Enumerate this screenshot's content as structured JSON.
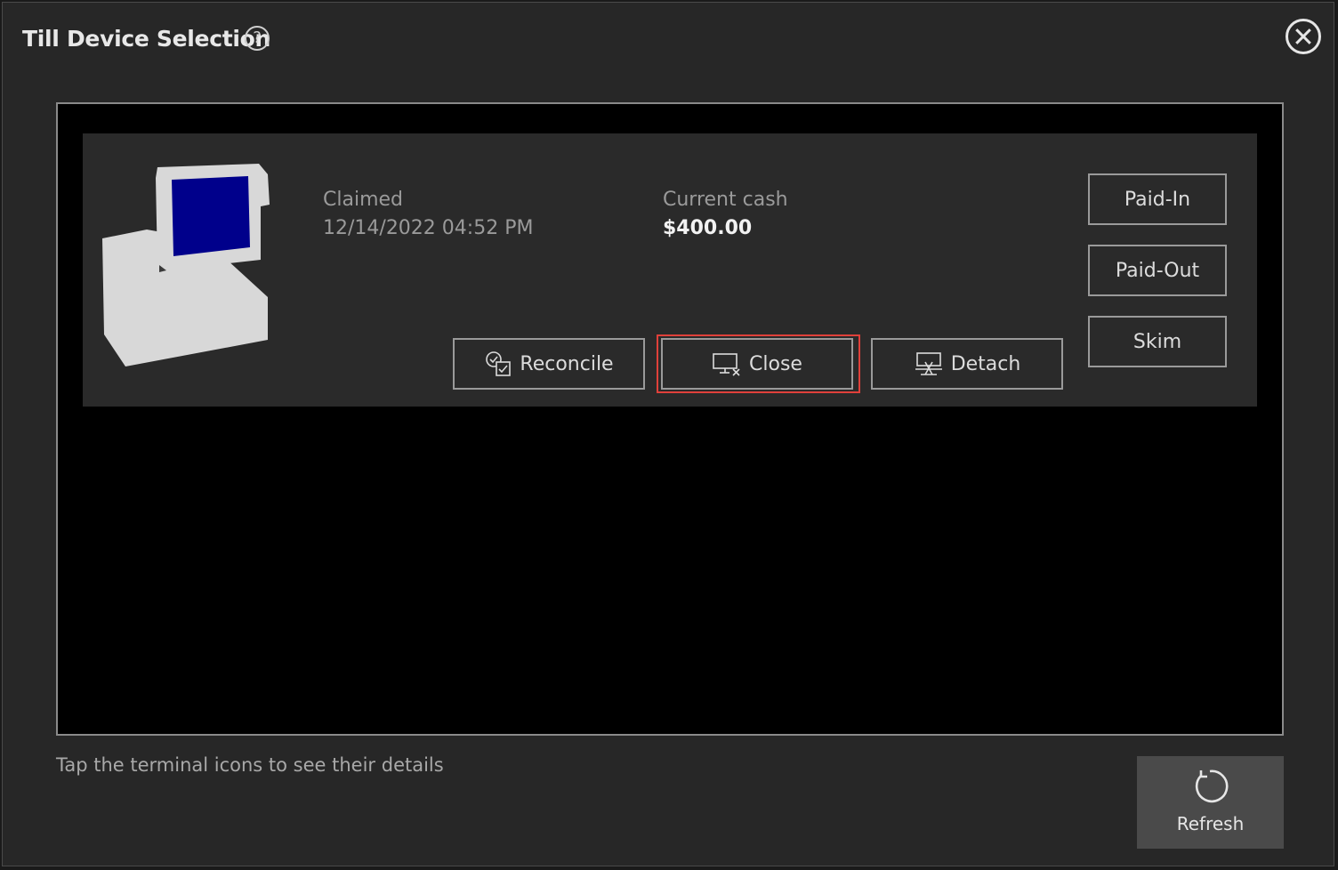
{
  "window": {
    "title": "Till Device Selection",
    "help_glyph": "?"
  },
  "till": {
    "status_label": "Claimed",
    "status_time": "12/14/2022 04:52 PM",
    "cash_label": "Current cash",
    "cash_value": "$400.00"
  },
  "actions": {
    "reconcile": "Reconcile",
    "close": "Close",
    "detach": "Detach",
    "paid_in": "Paid-In",
    "paid_out": "Paid-Out",
    "skim": "Skim"
  },
  "footer": {
    "hint": "Tap the terminal icons to see their details",
    "refresh": "Refresh"
  },
  "colors": {
    "accent_highlight": "#e0403a",
    "screen_blue": "#00008b"
  }
}
